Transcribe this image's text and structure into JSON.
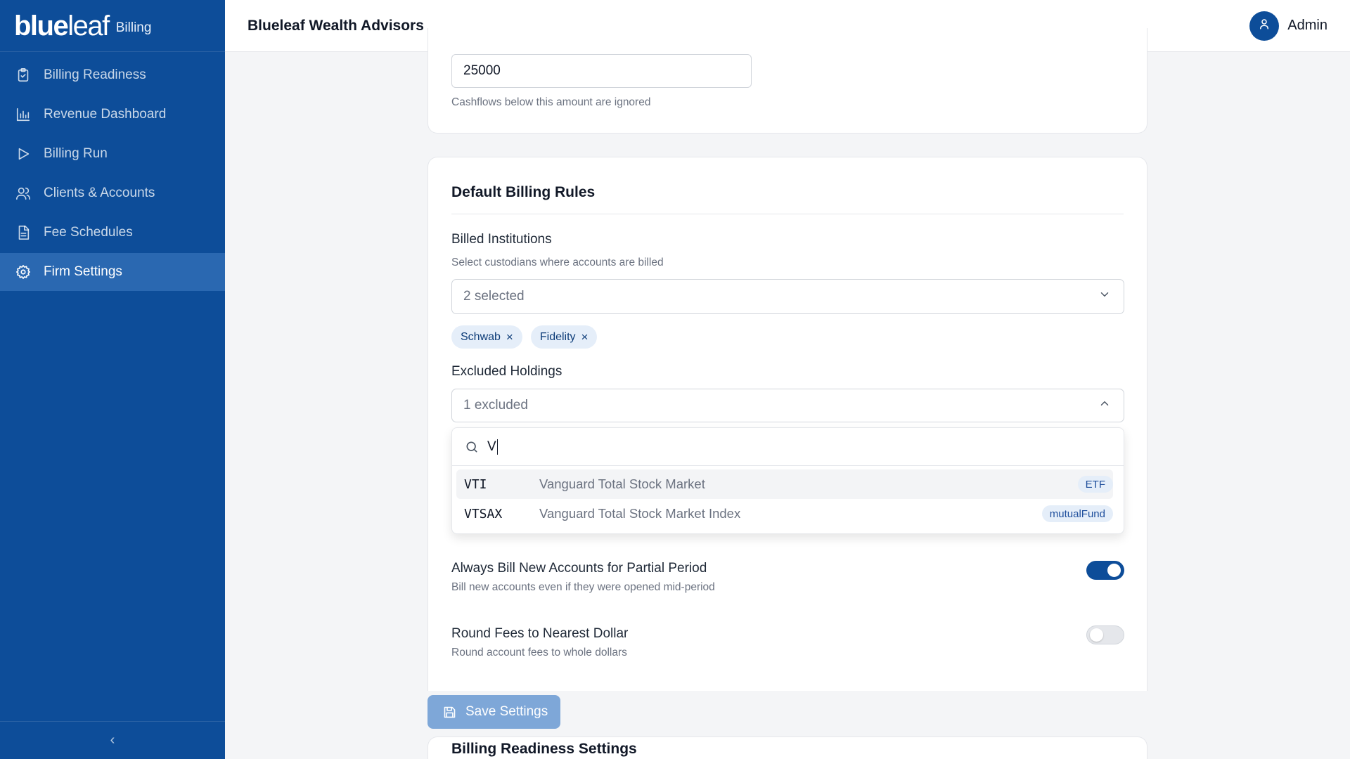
{
  "brand": {
    "logo_bold": "blue",
    "logo_light": "leaf",
    "product": "Billing"
  },
  "sidebar": {
    "items": [
      {
        "label": "Billing Readiness",
        "icon": "clipboard-check-icon"
      },
      {
        "label": "Revenue Dashboard",
        "icon": "bar-chart-icon"
      },
      {
        "label": "Billing Run",
        "icon": "play-icon"
      },
      {
        "label": "Clients & Accounts",
        "icon": "users-icon"
      },
      {
        "label": "Fee Schedules",
        "icon": "document-icon"
      },
      {
        "label": "Firm Settings",
        "icon": "gear-icon",
        "active": true
      }
    ],
    "collapse_label": "‹"
  },
  "header": {
    "firm_name": "Blueleaf Wealth Advisors",
    "user_name": "Admin"
  },
  "threshold": {
    "value": "25000",
    "help": "Cashflows below this amount are ignored"
  },
  "billing_rules": {
    "title": "Default Billing Rules",
    "institutions": {
      "label": "Billed Institutions",
      "help": "Select custodians where accounts are billed",
      "summary": "2 selected",
      "chips": [
        "Schwab",
        "Fidelity"
      ]
    },
    "excluded_holdings": {
      "label": "Excluded Holdings",
      "summary": "1 excluded",
      "search_value": "V",
      "options": [
        {
          "ticker": "VTI",
          "name": "Vanguard Total Stock Market",
          "type": "ETF"
        },
        {
          "ticker": "VTSAX",
          "name": "Vanguard Total Stock Market Index",
          "type": "mutualFund"
        }
      ]
    },
    "partial_period": {
      "label": "Always Bill New Accounts for Partial Period",
      "help": "Bill new accounts even if they were opened mid-period",
      "enabled": true
    },
    "round_fees": {
      "label": "Round Fees to Nearest Dollar",
      "help": "Round account fees to whole dollars",
      "enabled": false
    }
  },
  "save_button": {
    "label": "Save Settings"
  },
  "readiness_settings": {
    "title": "Billing Readiness Settings"
  },
  "colors": {
    "primary": "#0d4d99",
    "active_nav": "#2a68b1",
    "save_disabled": "#7ea7d8",
    "chip_bg": "#e5eef9"
  }
}
